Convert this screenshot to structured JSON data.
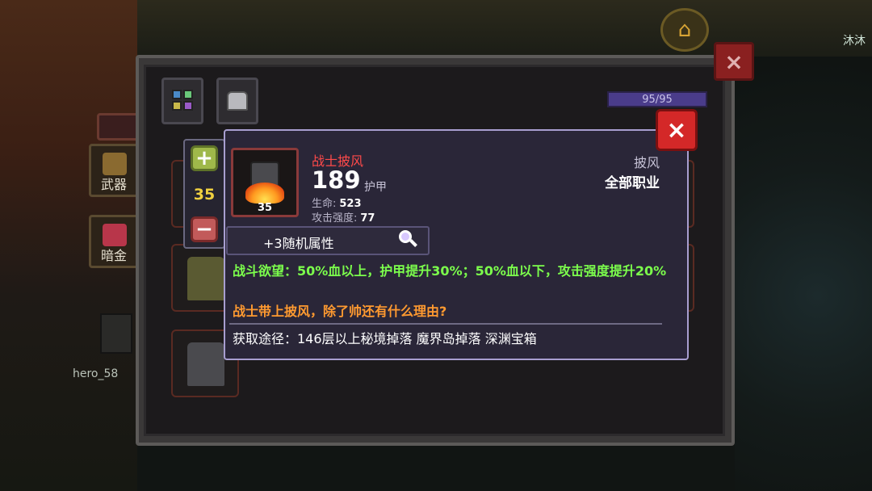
{
  "background": {
    "player_name_right": "沐沐",
    "player_name_left": "hero_58",
    "side_buttons": [
      {
        "label": "武器",
        "icon": "sword-icon"
      },
      {
        "label": "暗金",
        "icon": "chest-icon"
      }
    ]
  },
  "inventory": {
    "tabs": [
      {
        "name": "grid-tab",
        "icon": "grid-icon"
      },
      {
        "name": "bag-tab",
        "icon": "bag-icon"
      }
    ],
    "capacity": "95/95",
    "close_icon": "×",
    "quantity": "35",
    "plus": "+",
    "minus": "−"
  },
  "tooltip": {
    "close_icon": "×",
    "item_name": "战士披风",
    "item_level": "35",
    "armor_value": "189",
    "armor_label": "护甲",
    "stats": [
      {
        "label": "生命:",
        "value": "523"
      },
      {
        "label": "攻击强度:",
        "value": "77"
      }
    ],
    "item_type": "披风",
    "item_class": "全部职业",
    "random_attr": "+3随机属性",
    "effect": "战斗欲望：50%血以上，护甲提升30%；50%血以下，攻击强度提升20%",
    "flavor": "战士带上披风，除了帅还有什么理由?",
    "source": "获取途径：146层以上秘境掉落 魔界岛掉落 深渊宝箱"
  },
  "colors": {
    "item_name": "#ff4a4a",
    "effect": "#7cff4c",
    "flavor": "#ff9a30",
    "quantity": "#f0d040",
    "close_button": "#d42828"
  }
}
